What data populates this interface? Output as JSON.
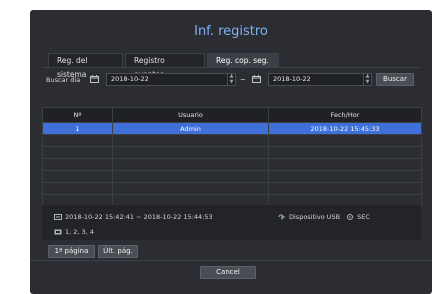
{
  "dialog": {
    "title": "Inf. registro"
  },
  "tabs": [
    {
      "label": "Reg. del sistema",
      "active": false
    },
    {
      "label": "Registro eventos",
      "active": false
    },
    {
      "label": "Reg. cop. seg.",
      "active": true
    }
  ],
  "search": {
    "label": "Buscar día",
    "start_date": "2018-10-22",
    "separator": "~",
    "end_date": "2018-10-22",
    "button": "Buscar"
  },
  "table": {
    "columns": [
      "Nº",
      "Usuario",
      "Fech/Hor"
    ],
    "rows": [
      {
        "no": "1",
        "user": "Admin",
        "datetime": "2018-10-22 15:45:33",
        "selected": true
      }
    ],
    "empty_rows": 6
  },
  "info": {
    "time_range": "2018-10-22 15:42:41 ~ 2018-10-22 15:44:53",
    "channels": "1, 2, 3, 4",
    "device": "Dispositivo USB",
    "format": "SEC"
  },
  "pagination": {
    "first": "1ª página",
    "last": "Últ. pág."
  },
  "footer": {
    "cancel": "Cancel"
  },
  "colors": {
    "accent": "#3f6fd8",
    "title": "#7fb1f0",
    "background": "#2b2d33"
  }
}
